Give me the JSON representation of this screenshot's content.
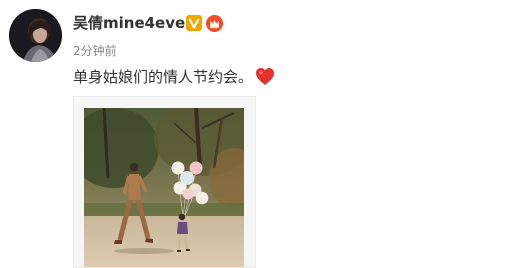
{
  "post": {
    "username": "吴倩mine4ever",
    "time": "2分钟前",
    "text": "单身姑娘们的情人节约会。"
  },
  "icons": {
    "avatar": "profile-photo",
    "verified": "verified-v-icon",
    "member": "member-crown-icon",
    "emoji": "red-heart-icon",
    "photo": "park-balloons-photo"
  },
  "colors": {
    "verified_badge": "#f2a400",
    "member_badge": "#f24c29",
    "heart": "#e5322d",
    "text": "#333333",
    "muted": "#888888"
  }
}
